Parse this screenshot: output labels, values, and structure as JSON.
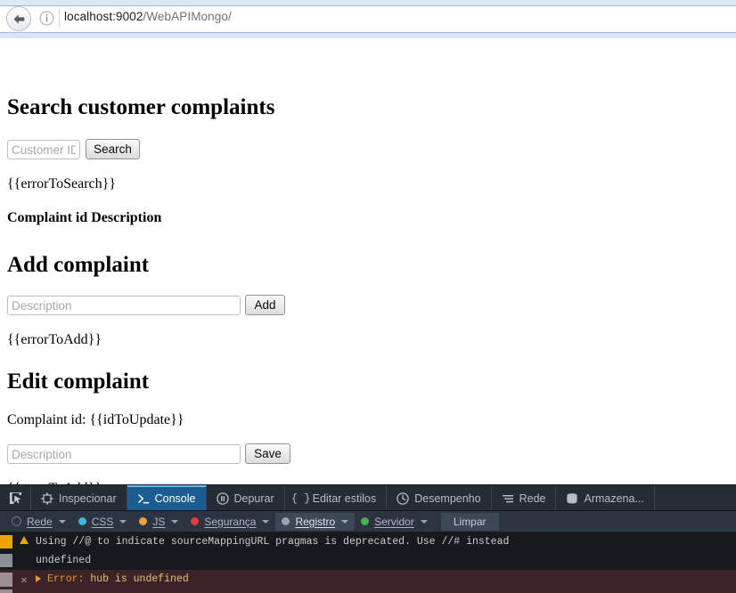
{
  "browser": {
    "back_icon": "back-arrow-icon",
    "info_icon": "info-icon",
    "url_host": "localhost:9002",
    "url_path": "/WebAPIMongo/"
  },
  "page": {
    "search_section": {
      "heading": "Search customer complaints",
      "customer_id_placeholder": "Customer ID",
      "customer_id_value": "",
      "search_button": "Search",
      "error_binding": "{{errorToSearch}}",
      "table_header": "Complaint id Description"
    },
    "add_section": {
      "heading": "Add complaint",
      "description_placeholder": "Description",
      "description_value": "",
      "add_button": "Add",
      "error_binding": "{{errorToAdd}}"
    },
    "edit_section": {
      "heading": "Edit complaint",
      "id_label": "Complaint id: {{idToUpdate}}",
      "description_placeholder": "Description",
      "description_value": "",
      "save_button": "Save",
      "error_binding": "{{errorToAdd}}"
    }
  },
  "devtools": {
    "picker_icon": "element-picker-icon",
    "tabs": [
      {
        "label": "Inspecionar",
        "icon": "inspector-icon",
        "selected": false
      },
      {
        "label": "Console",
        "icon": "console-prompt-icon",
        "selected": true
      },
      {
        "label": "Depurar",
        "icon": "debugger-pause-icon",
        "selected": false
      },
      {
        "label": "Editar estilos",
        "icon": "style-editor-icon",
        "selected": false
      },
      {
        "label": "Desempenho",
        "icon": "performance-icon",
        "selected": false
      },
      {
        "label": "Rede",
        "icon": "network-icon",
        "selected": false
      },
      {
        "label": "Armazena...",
        "icon": "storage-icon",
        "selected": false
      }
    ],
    "filters": [
      {
        "label": "Rede",
        "color": "#2b3440",
        "active": false
      },
      {
        "label": "CSS",
        "color": "#3ab8e0",
        "active": false
      },
      {
        "label": "JS",
        "color": "#e8a33d",
        "active": false
      },
      {
        "label": "Segurança",
        "color": "#e0403a",
        "active": false
      },
      {
        "label": "Registro",
        "color": "#9aa3ad",
        "active": true
      },
      {
        "label": "Servidor",
        "color": "#4caf50",
        "active": false
      }
    ],
    "clear_label": "Limpar",
    "messages": [
      {
        "type": "warning",
        "icon": "warning-triangle-icon",
        "text": "Using //@ to indicate sourceMappingURL pragmas is deprecated. Use //# instead"
      },
      {
        "type": "continuation",
        "icon": "",
        "text": "undefined"
      },
      {
        "type": "error",
        "icon": "error-x-icon",
        "keyword": "Error:",
        "text": "hub is undefined"
      }
    ]
  },
  "colors": {
    "chrome_blue": "#dfe9f6",
    "devtools_bg": "#232a33",
    "console_bg": "#161a1f",
    "error_row_bg": "#3c2328",
    "selected_tab": "#1c5c91",
    "warning_orange": "#f0a202"
  }
}
